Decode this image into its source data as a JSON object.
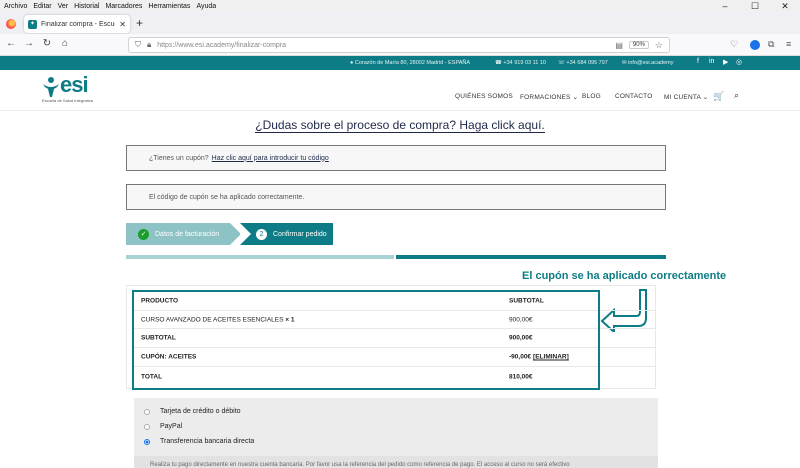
{
  "os_menu": [
    "Archivo",
    "Editar",
    "Ver",
    "Historial",
    "Marcadores",
    "Herramientas",
    "Ayuda"
  ],
  "window_controls": {
    "minimize": "–",
    "maximize": "☐",
    "close": "✕"
  },
  "browser": {
    "tab_title": "Finalizar compra - Escuela Salud",
    "tab_close": "✕",
    "new_tab": "+",
    "nav": {
      "back": "←",
      "forward": "→",
      "reload": "↻",
      "home": "⌂"
    },
    "url": "https://www.esi.academy/finalizar-compra",
    "zoom": "90%"
  },
  "site": {
    "contact": {
      "address": "Corazón de María 80, 28002 Madrid - ESPAÑA",
      "phone1": "+34 919 03 11 10",
      "phone2": "+34 684 095 797",
      "email": "info@esi.academy"
    },
    "social": [
      "f",
      "in",
      "▶",
      "◎"
    ],
    "logo": {
      "name": "esi",
      "tagline": "Escuela de Salud Integrativa"
    },
    "nav": [
      "QUIÉNES SOMOS",
      "FORMACIONES",
      "BLOG",
      "CONTACTO",
      "MI CUENTA"
    ],
    "nav_chevron": "⌄",
    "cart_icon": "🛒",
    "search_icon": "⌕"
  },
  "checkout": {
    "help_title": "¿Dudas sobre el proceso de compra? Haga click aquí.",
    "coupon_question": "¿Tienes un cupón?",
    "coupon_link": "Haz clic aquí para introducir tu código",
    "coupon_applied_msg": "El código de cupón se ha aplicado correctamente.",
    "steps": [
      {
        "icon": "✓",
        "label": "Datos de facturación"
      },
      {
        "icon": "2",
        "label": "Confirmar pedido"
      }
    ],
    "annotation": "El cupón se ha aplicado correctamente",
    "order": {
      "headers": {
        "product": "PRODUCTO",
        "subtotal": "SUBTOTAL"
      },
      "item": {
        "name": "CURSO AVANZADO DE ACEITES ESENCIALES",
        "qty": "× 1",
        "price": "900,00€"
      },
      "subtotal": {
        "label": "SUBTOTAL",
        "value": "900,00€"
      },
      "coupon": {
        "label": "CUPÓN: ACEITES",
        "value": "-90,00€",
        "remove": "[ELIMINAR]"
      },
      "total": {
        "label": "TOTAL",
        "value": "810,00€"
      }
    },
    "payment_methods": [
      {
        "label": "Tarjeta de crédito o débito",
        "selected": false
      },
      {
        "label": "PayPal",
        "selected": false
      },
      {
        "label": "Transferencia bancaria directa",
        "selected": true
      }
    ],
    "payment_desc": "Realiza tu pago directamente en nuestra cuenta bancaria. Por favor usa la referencia del pedido como referencia de pago. El acceso al curso no será efectivo"
  },
  "colors": {
    "brand": "#0e7c86",
    "brand_light": "#8ec3c6",
    "success": "#1a9e2a"
  }
}
